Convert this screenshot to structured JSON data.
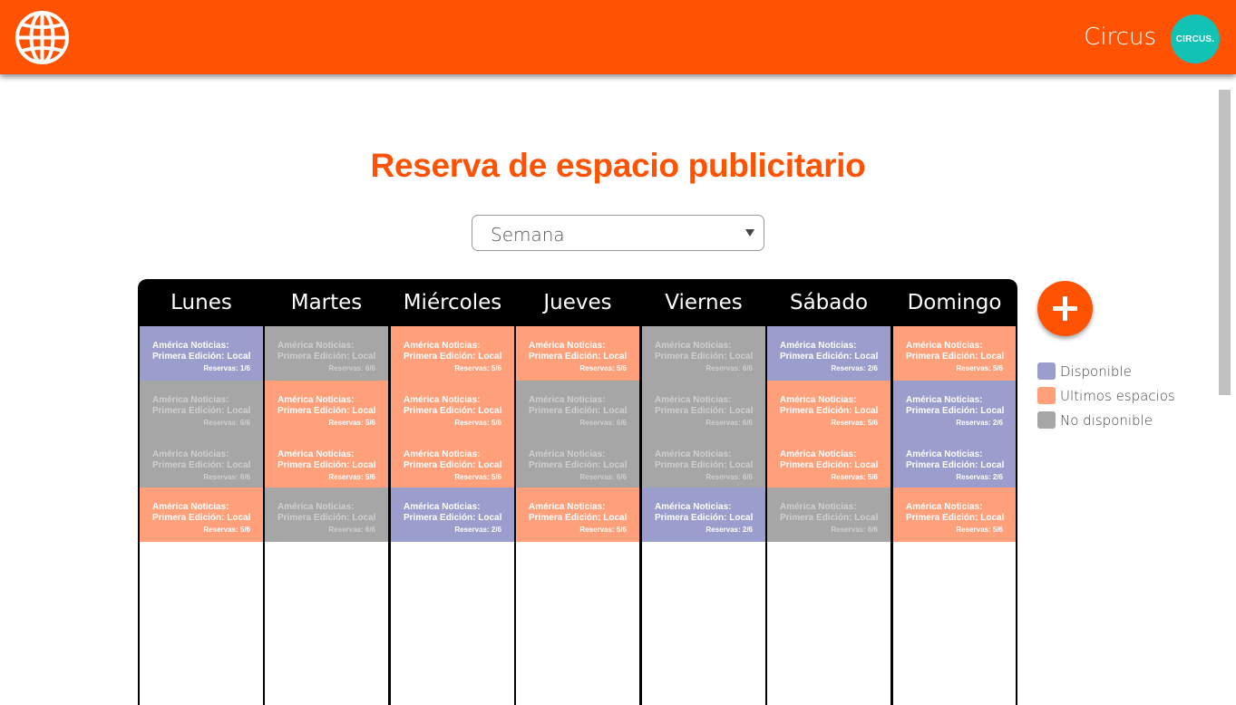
{
  "header": {
    "logo_icon": "globe-icon",
    "user_name": "Circus",
    "avatar_text": "CIRCUS.",
    "brand_color": "#ff5203",
    "avatar_color": "#12c3b5"
  },
  "main": {
    "title": "Reserva de espacio publicitario",
    "view_select": {
      "value": "Semana"
    },
    "add_icon": "plus-icon"
  },
  "colors": {
    "disponible": "#9b9dcc",
    "ultimos": "#ffa07a",
    "no": "#a6a6a6"
  },
  "legend": [
    {
      "label": "Disponible",
      "status": "disponible"
    },
    {
      "label": "Ultimos espacios",
      "status": "ultimos"
    },
    {
      "label": "No disponible",
      "status": "no"
    }
  ],
  "days": [
    {
      "name": "Lunes",
      "slots": [
        {
          "title": "América Noticias: Primera Edición: Local",
          "count": "Reservas: 1/6",
          "status": "disponible"
        },
        {
          "title": "América Noticias: Primera Edición: Local",
          "count": "Reservas: 6/6",
          "status": "no"
        },
        {
          "title": "América Noticias: Primera Edición: Local",
          "count": "Reservas: 6/6",
          "status": "no"
        },
        {
          "title": "América Noticias: Primera Edición: Local",
          "count": "Reservas: 5/6",
          "status": "ultimos"
        }
      ]
    },
    {
      "name": "Martes",
      "slots": [
        {
          "title": "América Noticias: Primera Edición: Local",
          "count": "Reservas: 6/6",
          "status": "no"
        },
        {
          "title": "América Noticias: Primera Edición: Local",
          "count": "Reservas: 5/6",
          "status": "ultimos"
        },
        {
          "title": "América Noticias: Primera Edición: Local",
          "count": "Reservas: 5/6",
          "status": "ultimos"
        },
        {
          "title": "América Noticias: Primera Edición: Local",
          "count": "Reservas: 6/6",
          "status": "no"
        }
      ]
    },
    {
      "name": "Miércoles",
      "slots": [
        {
          "title": "América Noticias: Primera Edición: Local",
          "count": "Reservas: 5/6",
          "status": "ultimos"
        },
        {
          "title": "América Noticias: Primera Edición: Local",
          "count": "Reservas: 5/6",
          "status": "ultimos"
        },
        {
          "title": "América Noticias: Primera Edición: Local",
          "count": "Reservas: 5/6",
          "status": "ultimos"
        },
        {
          "title": "América Noticias: Primera Edición: Local",
          "count": "Reservas: 2/6",
          "status": "disponible"
        }
      ]
    },
    {
      "name": "Jueves",
      "slots": [
        {
          "title": "América Noticias: Primera Edición: Local",
          "count": "Reservas: 5/6",
          "status": "ultimos"
        },
        {
          "title": "América Noticias: Primera Edición: Local",
          "count": "Reservas: 6/6",
          "status": "no"
        },
        {
          "title": "América Noticias: Primera Edición: Local",
          "count": "Reservas: 6/6",
          "status": "no"
        },
        {
          "title": "América Noticias: Primera Edición: Local",
          "count": "Reservas: 5/6",
          "status": "ultimos"
        }
      ]
    },
    {
      "name": "Viernes",
      "slots": [
        {
          "title": "América Noticias: Primera Edición: Local",
          "count": "Reservas: 6/6",
          "status": "no"
        },
        {
          "title": "América Noticias: Primera Edición: Local",
          "count": "Reservas: 6/6",
          "status": "no"
        },
        {
          "title": "América Noticias: Primera Edición: Local",
          "count": "Reservas: 6/6",
          "status": "no"
        },
        {
          "title": "América Noticias: Primera Edición: Local",
          "count": "Reservas: 2/6",
          "status": "disponible"
        }
      ]
    },
    {
      "name": "Sábado",
      "slots": [
        {
          "title": "América Noticias: Primera Edición: Local",
          "count": "Reservas: 2/6",
          "status": "disponible"
        },
        {
          "title": "América Noticias: Primera Edición: Local",
          "count": "Reservas: 5/6",
          "status": "ultimos"
        },
        {
          "title": "América Noticias: Primera Edición: Local",
          "count": "Reservas: 5/6",
          "status": "ultimos"
        },
        {
          "title": "América Noticias: Primera Edición: Local",
          "count": "Reservas: 6/6",
          "status": "no"
        }
      ]
    },
    {
      "name": "Domingo",
      "slots": [
        {
          "title": "América Noticias: Primera Edición: Local",
          "count": "Reservas: 5/6",
          "status": "ultimos"
        },
        {
          "title": "América Noticias: Primera Edición: Local",
          "count": "Reservas: 2/6",
          "status": "disponible"
        },
        {
          "title": "América Noticias: Primera Edición: Local",
          "count": "Reservas: 2/6",
          "status": "disponible"
        },
        {
          "title": "América Noticias: Primera Edición: Local",
          "count": "Reservas: 5/6",
          "status": "ultimos"
        }
      ]
    }
  ]
}
